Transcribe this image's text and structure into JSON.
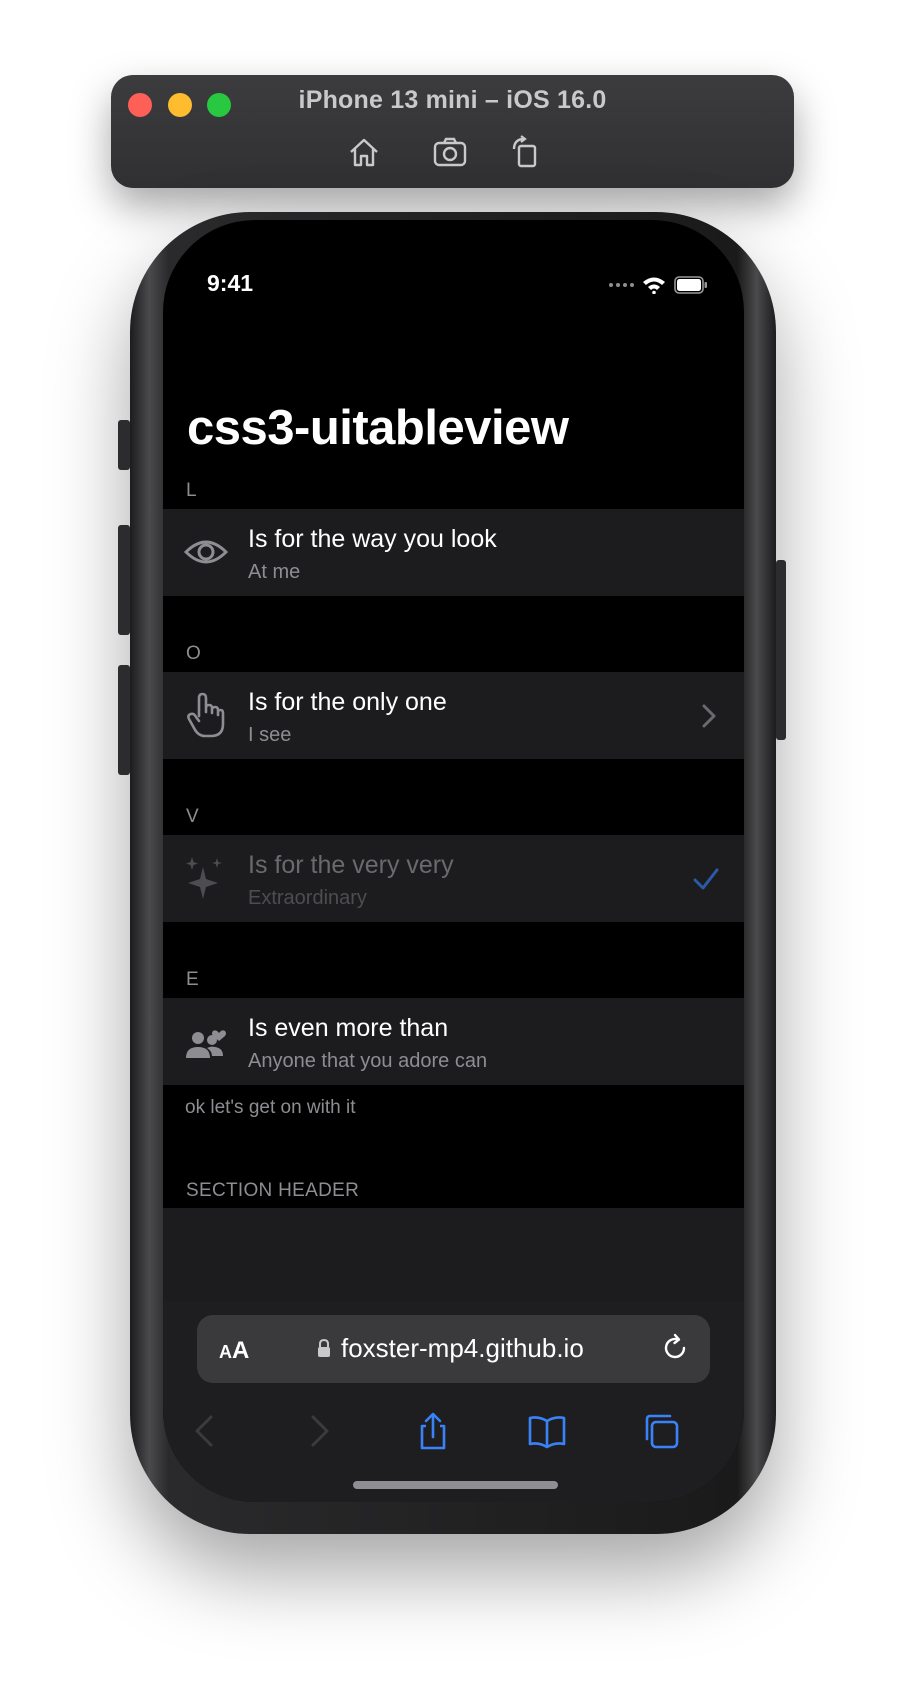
{
  "simulator": {
    "title": "iPhone 13 mini – iOS 16.0",
    "buttons": [
      "home-icon",
      "screenshot-icon",
      "rotate-icon"
    ]
  },
  "status_bar": {
    "time": "9:41"
  },
  "page": {
    "title": "css3-uitableview"
  },
  "sections": [
    {
      "header": "L",
      "title": "Is for the way you look",
      "subtitle": "At me",
      "icon": "eye-icon",
      "accessory": "none"
    },
    {
      "header": "O",
      "title": "Is for the only one",
      "subtitle": "I see",
      "icon": "hand-point-icon",
      "accessory": "chevron-right"
    },
    {
      "header": "V",
      "title": "Is for the very very",
      "subtitle": "Extraordinary",
      "icon": "sparkles-icon",
      "accessory": "checkmark"
    },
    {
      "header": "E",
      "title": "Is even more than",
      "subtitle": "Anyone that you adore can",
      "icon": "people-heart-icon",
      "accessory": "none"
    }
  ],
  "footer": "ok let's get on with it",
  "next_section_header": "SECTION HEADER",
  "safari": {
    "text_size_small": "A",
    "text_size_big": "A",
    "url": "foxster-mp4.github.io"
  },
  "colors": {
    "background": "#000000",
    "cell": "#1c1c1e",
    "secondary_text": "#8d8d92",
    "accent": "#3a82f7"
  }
}
